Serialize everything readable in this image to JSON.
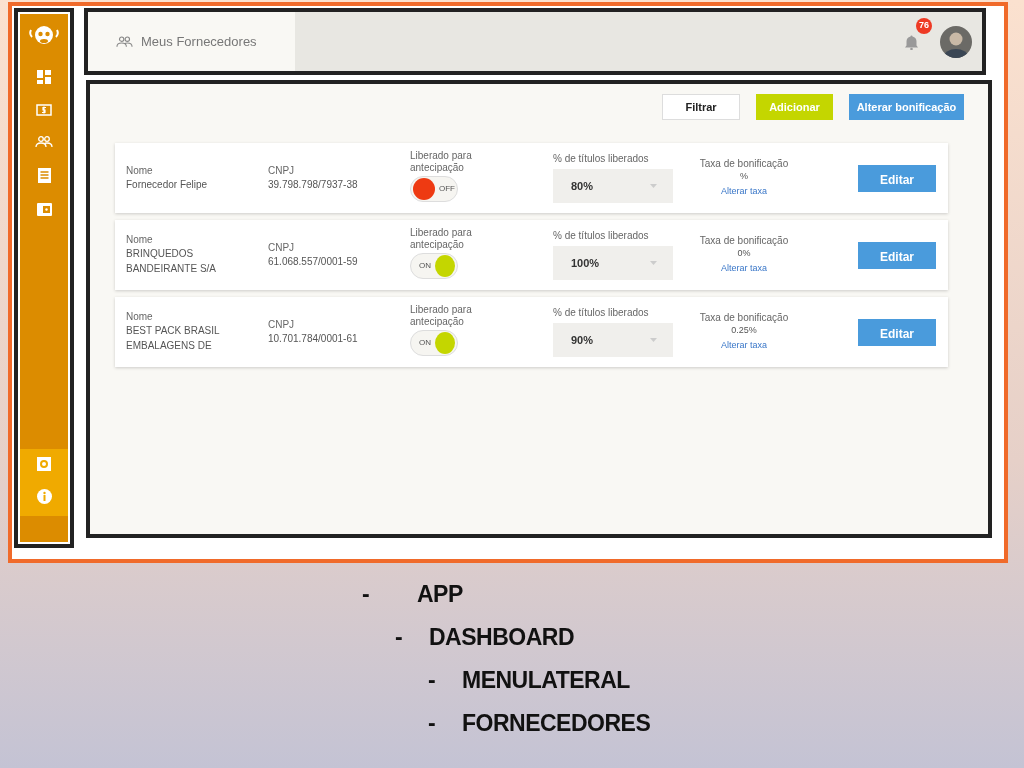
{
  "header": {
    "title": "Meus Fornecedores",
    "notifications": "76"
  },
  "actions": [
    {
      "label": "Filtrar",
      "kind": "outline"
    },
    {
      "label": "Adicionar",
      "kind": "lime"
    },
    {
      "label": "Alterar bonificação",
      "kind": "blue"
    }
  ],
  "suppliers": [
    {
      "name_label": "Nome",
      "name": "Fornecedor Felipe",
      "cnpj_label": "CNPJ",
      "cnpj": "39.798.798/7937-38",
      "toggle_label": "Liberado para antecipação",
      "on": false,
      "toggle_text": "OFF",
      "percent_label": "% de títulos liberados",
      "percent": "80%",
      "rate_label": "Taxa de bonificação",
      "rate": "%",
      "rate_link": "Alterar taxa",
      "edit": "Editar"
    },
    {
      "name_label": "Nome",
      "name": "BRINQUEDOS BANDEIRANTE S/A",
      "cnpj_label": "CNPJ",
      "cnpj": "61.068.557/0001-59",
      "toggle_label": "Liberado para antecipação",
      "on": true,
      "toggle_text": "ON",
      "percent_label": "% de títulos liberados",
      "percent": "100%",
      "rate_label": "Taxa de bonificação",
      "rate": "0%",
      "rate_link": "Alterar taxa",
      "edit": "Editar"
    },
    {
      "name_label": "Nome",
      "name": "BEST PACK BRASIL EMBALAGENS DE",
      "cnpj_label": "CNPJ",
      "cnpj": "10.701.784/0001-61",
      "toggle_label": "Liberado para antecipação",
      "on": true,
      "toggle_text": "ON",
      "percent_label": "% de títulos liberados",
      "percent": "90%",
      "rate_label": "Taxa de bonificação",
      "rate": "0.25%",
      "rate_link": "Alterar taxa",
      "edit": "Editar"
    }
  ],
  "outline": [
    {
      "bullet": "-",
      "label": "APP",
      "children": [
        {
          "bullet": "-",
          "label": "DASHBOARD",
          "children": [
            {
              "bullet": "-",
              "label": "MENULATERAL"
            },
            {
              "bullet": "-",
              "label": "FORNECEDORES"
            }
          ]
        }
      ]
    }
  ]
}
